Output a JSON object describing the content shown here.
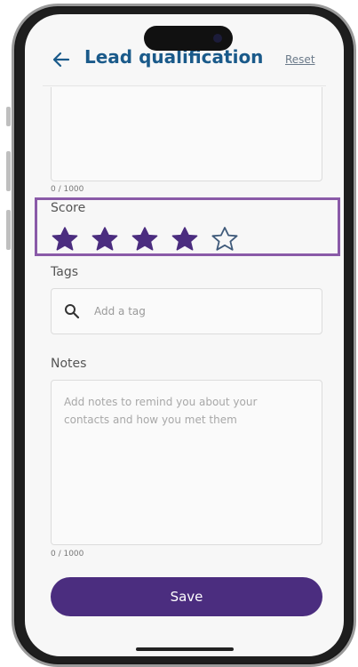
{
  "header": {
    "title": "Lead qualification",
    "reset_label": "Reset"
  },
  "top_field": {
    "counter": "0 / 1000"
  },
  "score": {
    "label": "Score",
    "value": 4,
    "max": 5,
    "star_color": "#4b2d7f",
    "highlight_color": "#8a5aa8"
  },
  "tags": {
    "label": "Tags",
    "placeholder": "Add a tag"
  },
  "notes": {
    "label": "Notes",
    "placeholder": "Add notes to remind you about your contacts and how you met them",
    "counter": "0 / 1000"
  },
  "save_label": "Save",
  "colors": {
    "title": "#1a5a8a",
    "primary": "#4b2d7f"
  }
}
